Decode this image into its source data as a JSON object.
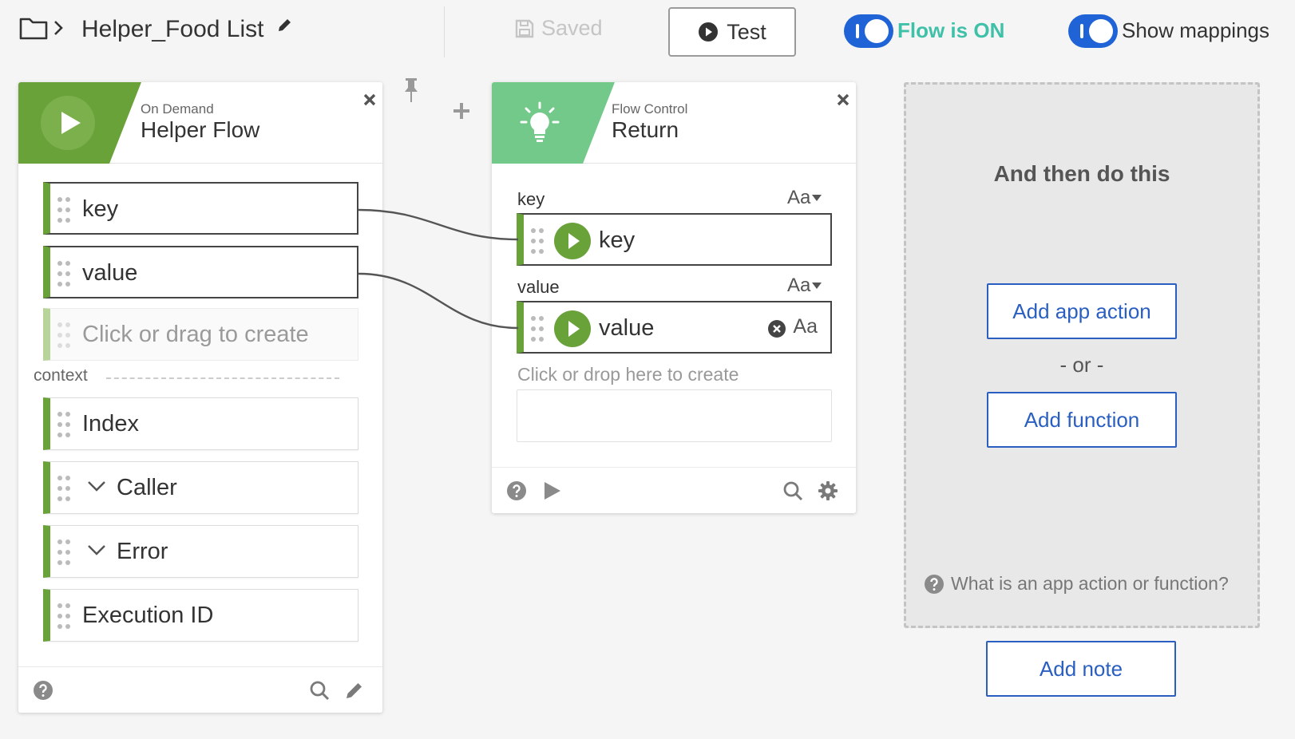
{
  "header": {
    "title": "Helper_Food List",
    "saved_label": "Saved",
    "test_label": "Test",
    "flow_toggle_label": "Flow is ON",
    "mappings_toggle_label": "Show mappings"
  },
  "colors": {
    "trigger_green": "#6aa23a",
    "control_green": "#72c98a",
    "accent_blue": "#2a5fc1",
    "toggle_blue": "#1f63d6",
    "flow_on_teal": "#3fc0a8"
  },
  "trigger_card": {
    "subtitle": "On Demand",
    "title": "Helper Flow",
    "icon": "play-icon",
    "fields": [
      "key",
      "value"
    ],
    "create_placeholder": "Click or drag to create",
    "context_label": "context",
    "context_fields": [
      {
        "label": "Index",
        "expandable": false
      },
      {
        "label": "Caller",
        "expandable": true
      },
      {
        "label": "Error",
        "expandable": true
      },
      {
        "label": "Execution ID",
        "expandable": false
      }
    ]
  },
  "return_card": {
    "subtitle": "Flow Control",
    "title": "Return",
    "icon": "lightbulb-icon",
    "inputs": [
      {
        "label": "key",
        "type_toggle": "Aa",
        "mapped": "key",
        "clearable": false
      },
      {
        "label": "value",
        "type_toggle": "Aa",
        "mapped": "value",
        "clearable": true,
        "type_badge": "Aa"
      }
    ],
    "drop_placeholder": "Click or drop here to create"
  },
  "then_panel": {
    "title": "And then do this",
    "add_app_action": "Add app action",
    "or_label": "- or -",
    "add_function": "Add function",
    "help_text": "What is an app action or function?"
  },
  "add_note": "Add note"
}
